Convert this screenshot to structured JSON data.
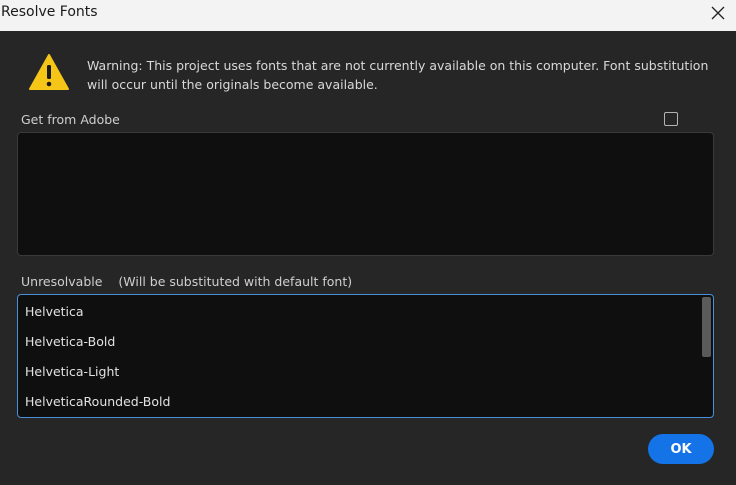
{
  "window": {
    "title": "Resolve Fonts",
    "close_icon": "close-icon"
  },
  "warning": {
    "icon": "warning-icon",
    "text": "Warning: This project uses fonts that are not currently available on this computer. Font substitution will occur until the originals become available."
  },
  "get_from_adobe": {
    "label": "Get from Adobe",
    "checked": false,
    "items": []
  },
  "unresolvable": {
    "label": "Unresolvable",
    "note": "(Will be substituted with default font)",
    "items": [
      "Helvetica",
      "Helvetica-Bold",
      "Helvetica-Light",
      "HelveticaRounded-Bold"
    ]
  },
  "ok_button": {
    "label": "OK"
  },
  "colors": {
    "accent": "#1473e6",
    "background": "#262626",
    "list_bg": "#0f0f0f",
    "warning": "#f5c518"
  }
}
